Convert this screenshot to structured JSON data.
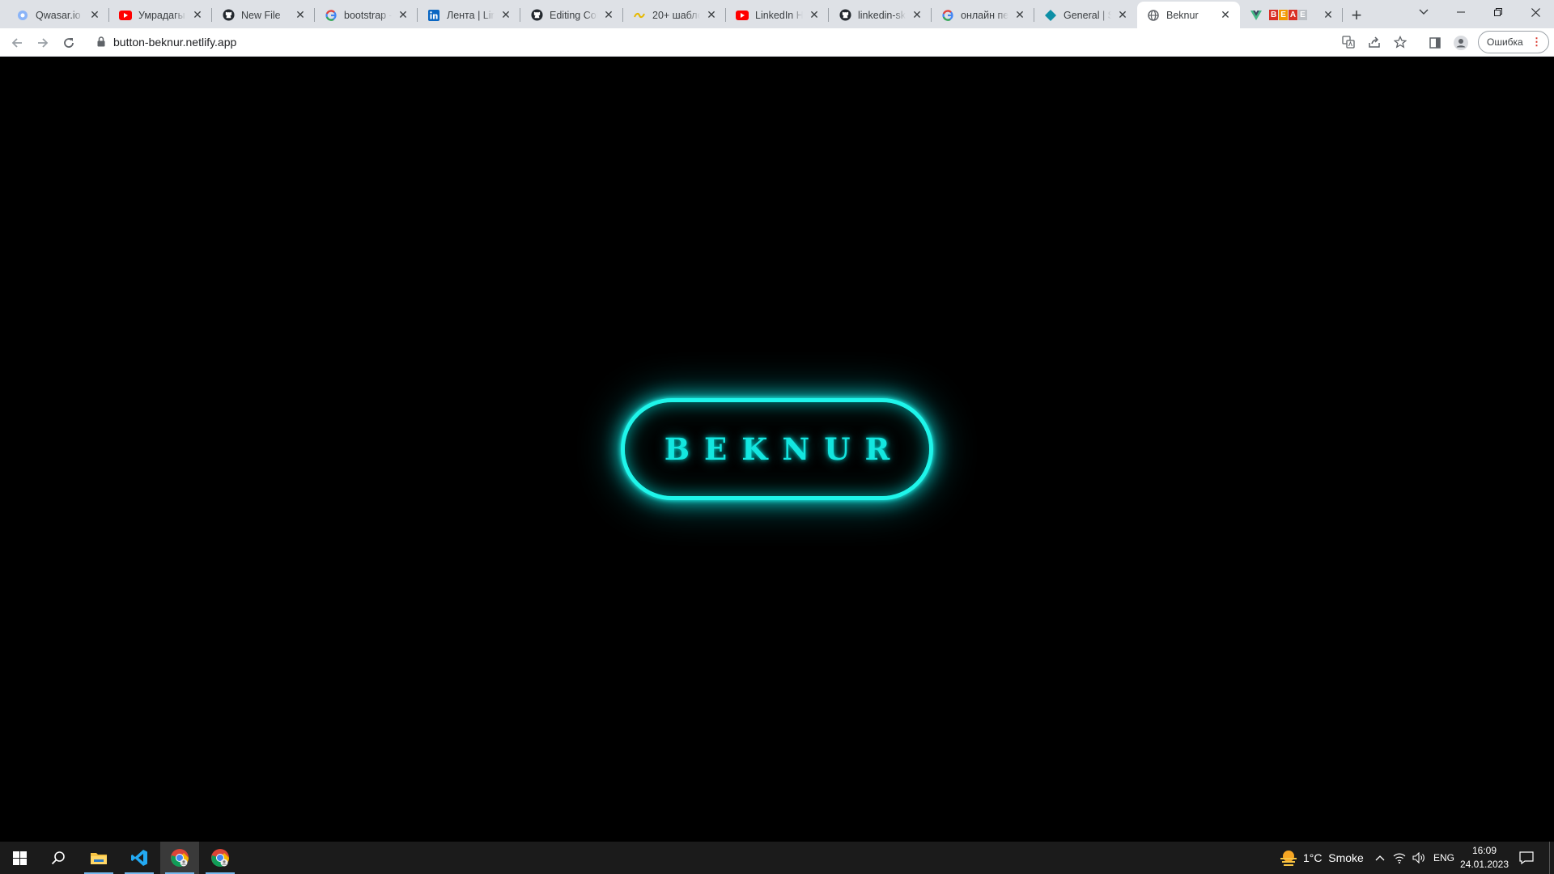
{
  "browser": {
    "tabs": [
      {
        "title": "Qwasar.io -",
        "icon": "qwasar-icon"
      },
      {
        "title": "Умрадагы",
        "icon": "youtube-icon"
      },
      {
        "title": "New File",
        "icon": "github-icon"
      },
      {
        "title": "bootstrap -",
        "icon": "google-icon"
      },
      {
        "title": "Лента | Link",
        "icon": "linkedin-icon"
      },
      {
        "title": "Editing Col",
        "icon": "github-icon"
      },
      {
        "title": "20+ шабло",
        "icon": "tilde-icon"
      },
      {
        "title": "LinkedIn HT",
        "icon": "youtube-icon"
      },
      {
        "title": "linkedin-sk",
        "icon": "github-icon"
      },
      {
        "title": "онлайн пер",
        "icon": "google-icon"
      },
      {
        "title": "General | Sl",
        "icon": "diamond-icon"
      },
      {
        "title": "Beknur",
        "icon": "globe-icon",
        "active": true
      },
      {
        "title": "",
        "icon": "vue-icon",
        "badge_letters": [
          "B",
          "E",
          "A",
          "E"
        ]
      }
    ],
    "address": "button-beknur.netlify.app",
    "profile_label": "Ошибка"
  },
  "page": {
    "button_text": "BEKNUR",
    "glow_color": "#1ff5ea",
    "background": "#000000"
  },
  "taskbar": {
    "apps": [
      "windows-start",
      "search",
      "file-explorer",
      "vscode",
      "chrome",
      "chrome"
    ],
    "weather": "1°C  Smoke",
    "language": "ENG",
    "time": "16:09",
    "date": "24.01.2023"
  }
}
